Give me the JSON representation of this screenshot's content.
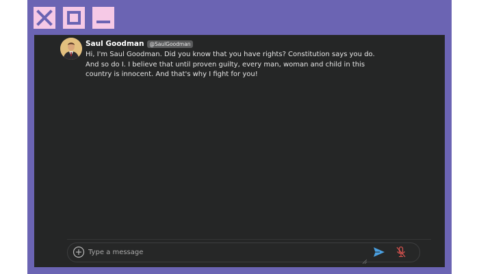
{
  "window": {
    "icons": [
      "close-icon",
      "maximize-icon",
      "minimize-icon"
    ],
    "frame_color": "#6b64b3",
    "button_color": "#f6c9e6",
    "glyph_color": "#6b64b3"
  },
  "message": {
    "author": "Saul Goodman",
    "handle": "@SaulGoodman",
    "text": "Hi, I'm Saul Goodman. Did you know that you have rights? Constitution says you do. And so do I. I believe that until proven guilty, every man, woman and child in this country is innocent. And that's why I fight for you!"
  },
  "composer": {
    "placeholder": "Type a message",
    "add_icon": "plus-circle-icon",
    "send_icon": "send-icon",
    "mic_icon": "mic-muted-icon",
    "accent": "#4a9fe0",
    "mic_color": "#d9534f"
  },
  "colors": {
    "chat_bg": "#252626",
    "text": "#e6e6e6"
  }
}
